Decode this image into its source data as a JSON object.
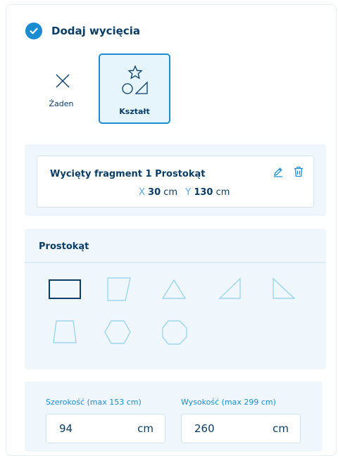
{
  "section": {
    "title": "Dodaj wycięcia"
  },
  "options": [
    {
      "label": "Żaden",
      "icon": "x-icon"
    },
    {
      "label": "Kształt",
      "icon": "shapes-icon",
      "selected": true
    }
  ],
  "cut": {
    "title_prefix": "Wycięty fragment 1",
    "shape": "Prostokąt",
    "x_label": "X",
    "x_value": "30",
    "y_label": "Y",
    "y_value": "130",
    "unit": "cm"
  },
  "shapes": {
    "title": "Prostokąt",
    "items": [
      "rectangle-icon",
      "parallelogram-icon",
      "triangle-icon",
      "right-triangle-icon",
      "right-triangle-flipped-icon",
      "trapezoid-icon",
      "hexagon-icon",
      "octagon-icon"
    ],
    "selected": "rectangle-icon"
  },
  "dimensions": {
    "width_label": "Szerokość (max 153 cm)",
    "width_value": "94",
    "height_label": "Wysokość (max 299 cm)",
    "height_value": "260",
    "unit": "cm"
  },
  "colors": {
    "accent": "#1a8ccf",
    "text": "#0a3d66",
    "panel": "#f0f7fc"
  }
}
